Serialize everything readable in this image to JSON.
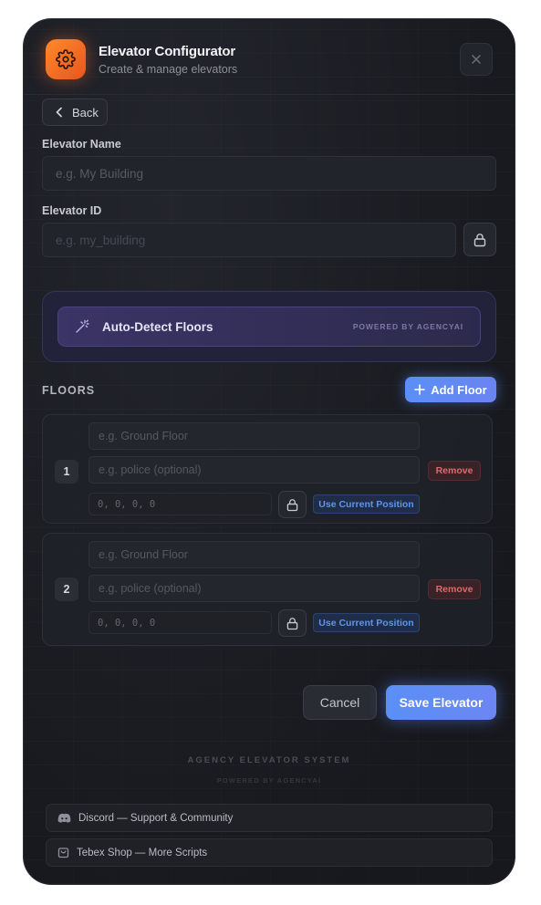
{
  "header": {
    "title": "Elevator Configurator",
    "subtitle": "Create & manage elevators",
    "app_icon": "gear-icon",
    "close_icon": "close-icon"
  },
  "nav": {
    "back_label": "Back"
  },
  "form": {
    "elevator_name": {
      "label": "Elevator Name",
      "value": "",
      "placeholder": "e.g. My Building"
    },
    "elevator_id": {
      "label": "Elevator ID",
      "value": "",
      "placeholder": "e.g. my_building"
    }
  },
  "auto_detect": {
    "label": "Auto-Detect Floors",
    "powered_by": "POWERED BY AGENCYAI",
    "icon": "magic-wand-icon"
  },
  "floors_section": {
    "heading": "FLOORS",
    "add_label": "Add Floor",
    "floors": [
      {
        "number": "1",
        "name_placeholder": "e.g. Ground Floor",
        "job_placeholder": "e.g. police (optional)",
        "coords_placeholder": "0, 0, 0, 0",
        "remove_label": "Remove",
        "use_position_label": "Use Current Position"
      },
      {
        "number": "2",
        "name_placeholder": "e.g. Ground Floor",
        "job_placeholder": "e.g. police (optional)",
        "coords_placeholder": "0, 0, 0, 0",
        "remove_label": "Remove",
        "use_position_label": "Use Current Position"
      }
    ]
  },
  "actions": {
    "cancel_label": "Cancel",
    "save_label": "Save Elevator"
  },
  "footer": {
    "system_name": "AGENCY ELEVATOR SYSTEM",
    "powered_by": "POWERED BY AGENCYAI",
    "links": [
      {
        "label": "Discord — Support & Community",
        "icon": "discord-icon"
      },
      {
        "label": "Tebex Shop — More Scripts",
        "icon": "shopping-bag-icon"
      }
    ]
  },
  "colors": {
    "accent_blue": "#5b8ff6",
    "accent_orange": "#ff7a2a",
    "danger_red": "#e0686b",
    "panel_bg": "#1b1d24"
  }
}
